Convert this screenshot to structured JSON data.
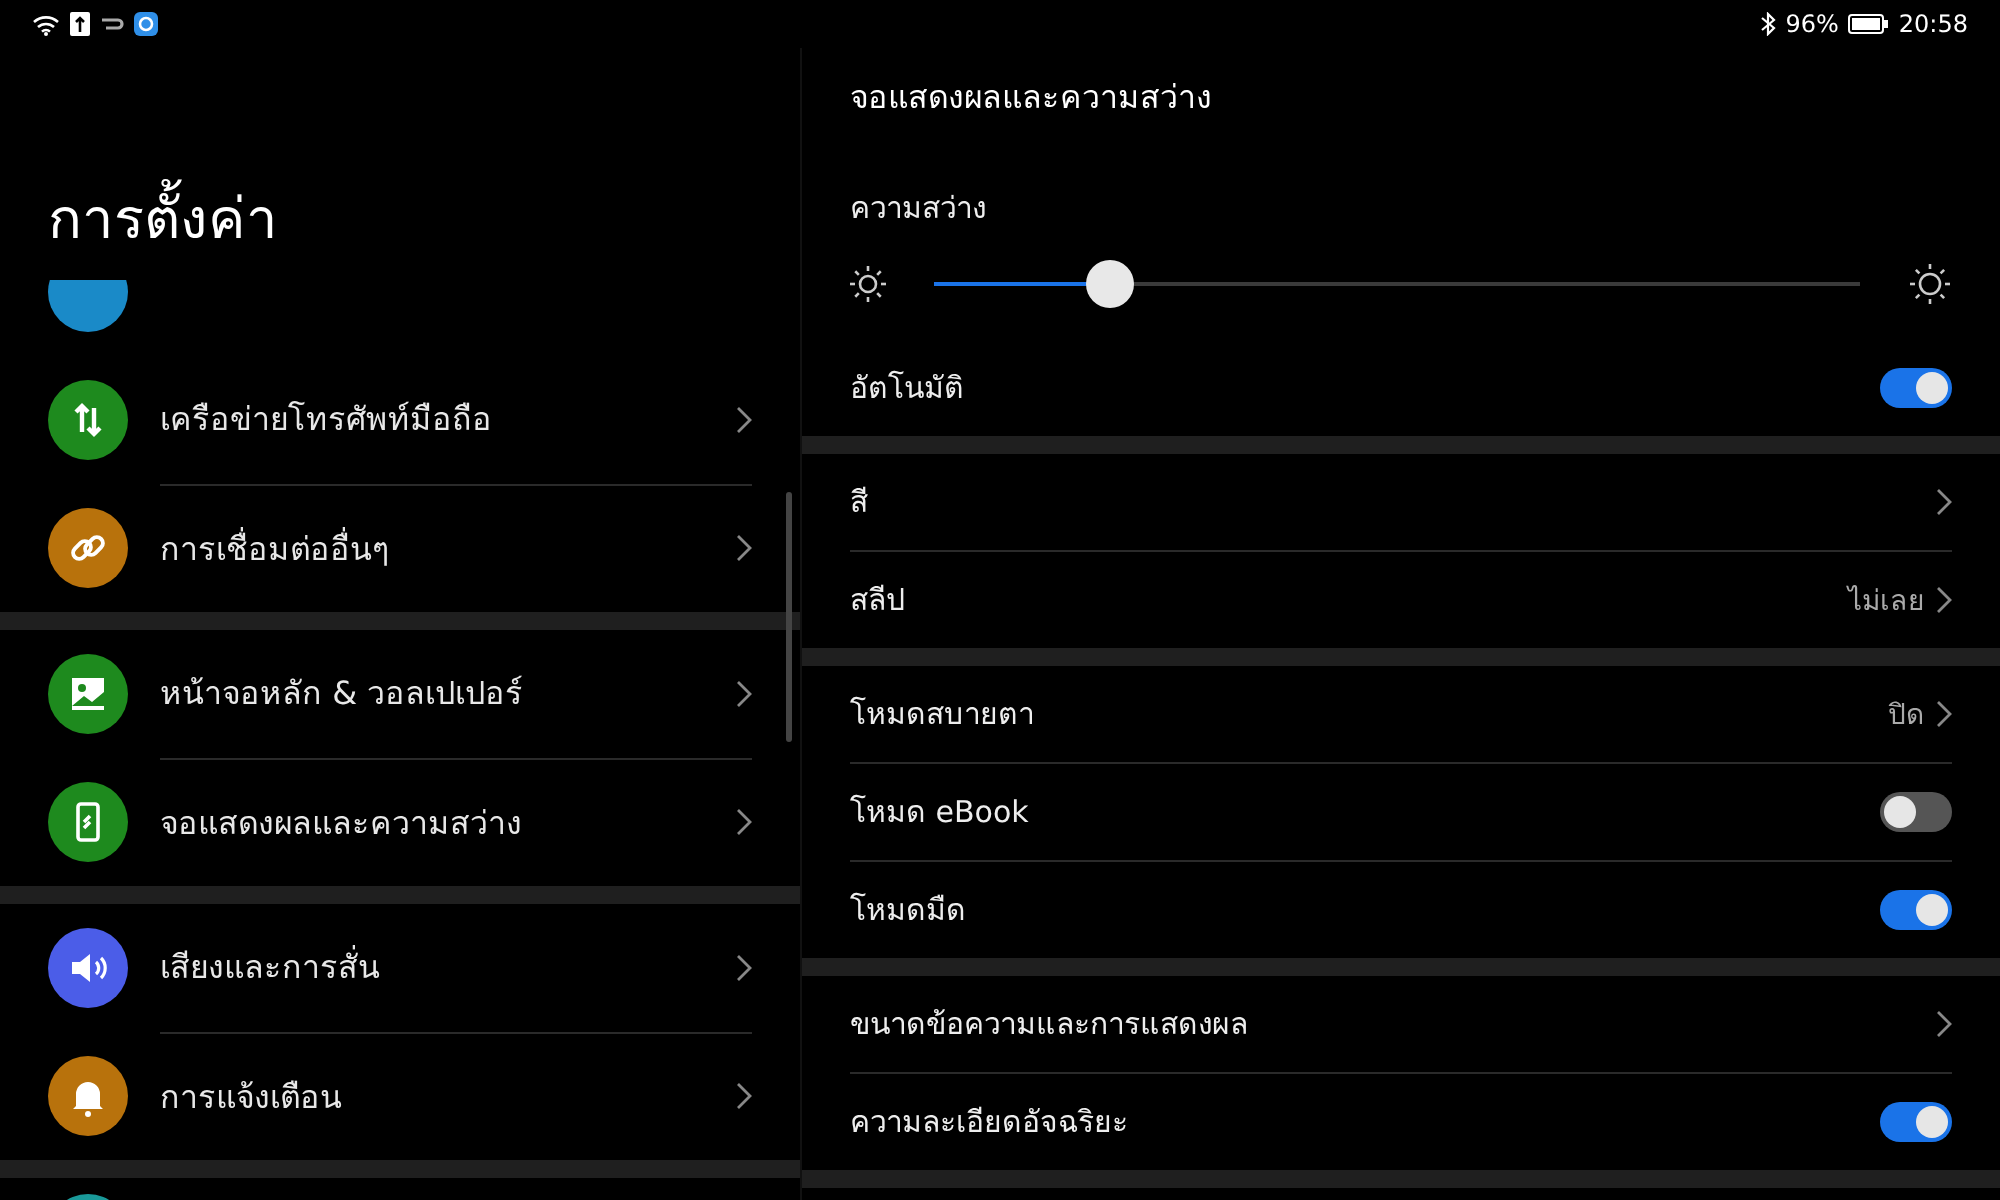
{
  "status_bar": {
    "battery": "96%",
    "time": "20:58"
  },
  "sidebar": {
    "title": "การตั้งค่า",
    "groups": [
      [
        {
          "kind": "partial",
          "color": "#1a8ac8"
        },
        {
          "kind": "arrows",
          "label": "เครือข่ายโทรศัพท์มือถือ",
          "color": "#1e8a1e"
        },
        {
          "kind": "link",
          "label": "การเชื่อมต่ออื่นๆ",
          "color": "#b8720c"
        }
      ],
      [
        {
          "kind": "image",
          "label": "หน้าจอหลัก & วอลเปเปอร์",
          "color": "#1e8a1e"
        },
        {
          "kind": "phone",
          "label": "จอแสดงผลและความสว่าง",
          "color": "#1e8a1e"
        }
      ],
      [
        {
          "kind": "speaker",
          "label": "เสียงและการสั่น",
          "color": "#4b5de8"
        },
        {
          "kind": "bell",
          "label": "การแจ้งเตือน",
          "color": "#b8720c"
        }
      ],
      [
        {
          "kind": "partial",
          "color": "#1a9a9a"
        }
      ]
    ]
  },
  "detail": {
    "title": "จอแสดงผลและความสว่าง",
    "brightness": {
      "label": "ความสว่าง",
      "level": 0.19
    },
    "sections": [
      [
        {
          "kind": "toggle",
          "label": "อัตโนมัติ",
          "on": true
        }
      ],
      [
        {
          "kind": "chevron",
          "label": "สี"
        },
        {
          "kind": "chevron",
          "label": "สลีป",
          "value": "ไม่เลย"
        }
      ],
      [
        {
          "kind": "chevron",
          "label": "โหมดสบายตา",
          "value": "ปิด"
        },
        {
          "kind": "toggle",
          "label": "โหมด eBook",
          "on": false
        },
        {
          "kind": "toggle",
          "label": "โหมดมืด",
          "on": true
        }
      ],
      [
        {
          "kind": "chevron",
          "label": "ขนาดข้อความและการแสดงผล"
        },
        {
          "kind": "toggle",
          "label": "ความละเอียดอัจฉริยะ",
          "on": true
        }
      ]
    ]
  }
}
